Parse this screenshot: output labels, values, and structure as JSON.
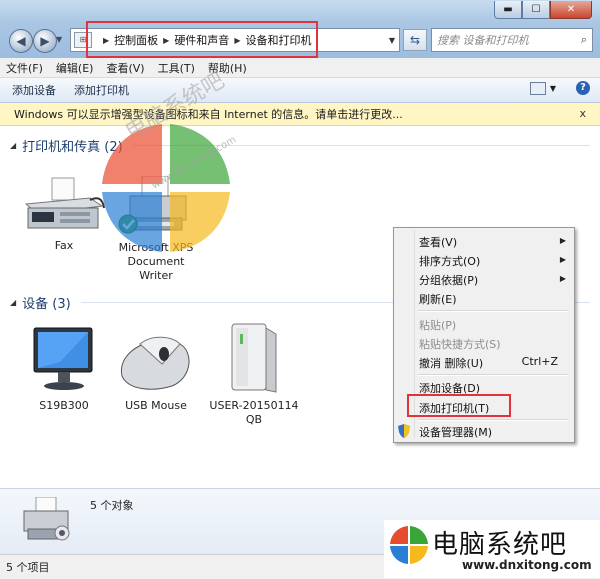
{
  "window": {
    "controls": {
      "minimize": "▬",
      "maximize": "☐",
      "close": "✕"
    }
  },
  "address": {
    "breadcrumbs": [
      "控制面板",
      "硬件和声音",
      "设备和打印机"
    ],
    "search_placeholder": "搜索 设备和打印机"
  },
  "menubar": [
    "文件(F)",
    "编辑(E)",
    "查看(V)",
    "工具(T)",
    "帮助(H)"
  ],
  "commandbar": {
    "add_device": "添加设备",
    "add_printer": "添加打印机",
    "help": "?"
  },
  "infobar": {
    "message": "Windows 可以显示增强型设备图标和来自 Internet 的信息。请单击进行更改...",
    "close": "x"
  },
  "groups": [
    {
      "title": "打印机和传真 (2)",
      "items": [
        {
          "label": "Fax"
        },
        {
          "label_lines": [
            "Microsoft XPS",
            "Document",
            "Writer"
          ]
        }
      ]
    },
    {
      "title": "设备 (3)",
      "items": [
        {
          "label": "S19B300"
        },
        {
          "label": "USB Mouse"
        },
        {
          "label_lines": [
            "USER-20150114",
            "QB"
          ]
        }
      ]
    }
  ],
  "context_menu": [
    {
      "label": "查看(V)",
      "submenu": true
    },
    {
      "label": "排序方式(O)",
      "submenu": true
    },
    {
      "label": "分组依据(P)",
      "submenu": true
    },
    {
      "label": "刷新(E)"
    },
    {
      "label": "粘贴(P)",
      "disabled": true
    },
    {
      "label": "粘贴快捷方式(S)",
      "disabled": true
    },
    {
      "label": "撤消 删除(U)",
      "accelerator": "Ctrl+Z"
    },
    {
      "label": "添加设备(D)"
    },
    {
      "label": "添加打印机(T)",
      "highlighted": true
    },
    {
      "label": "设备管理器(M)",
      "icon": "shield-icon"
    }
  ],
  "details": {
    "count": "5 个对象"
  },
  "status": {
    "text": "5 个项目"
  },
  "watermark": {
    "brand": "电脑系统吧",
    "url": "www.dnxitong.com"
  },
  "colors": {
    "highlight_box": "#e0343a",
    "infobar_bg": "#fff6c4",
    "group_title": "#1e3d6e"
  }
}
